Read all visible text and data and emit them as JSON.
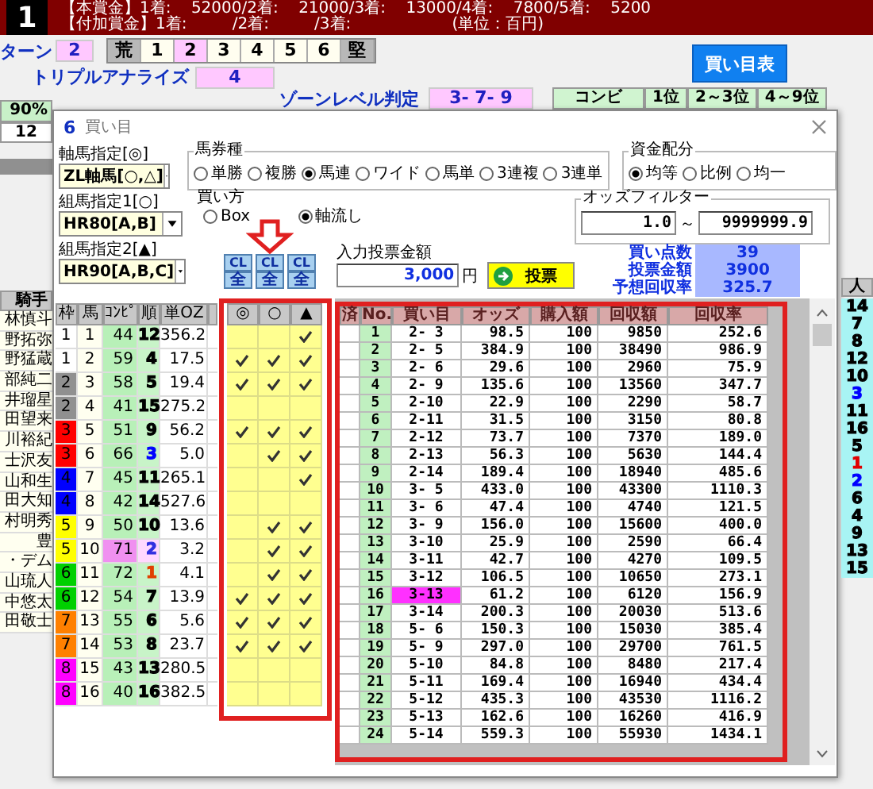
{
  "banner": {
    "race_number": "1",
    "lines": [
      "【本賞金】1着:    52000/2着:    21000/3着:    13000/4着:    7800/5着:    5200",
      "【付加賞金】1着:         /2着:         /3着:                    (単位：百円)"
    ]
  },
  "pattern": {
    "label": "ターン",
    "value": "2",
    "segments": [
      {
        "label": "荒",
        "kind": "cap",
        "selected": false
      },
      {
        "label": "1",
        "kind": "level",
        "selected": false
      },
      {
        "label": "2",
        "kind": "level",
        "selected": true
      },
      {
        "label": "3",
        "kind": "level",
        "selected": false
      },
      {
        "label": "4",
        "kind": "level",
        "selected": false
      },
      {
        "label": "5",
        "kind": "level",
        "selected": false
      },
      {
        "label": "6",
        "kind": "level",
        "selected": false
      },
      {
        "label": "堅",
        "kind": "cap",
        "selected": false
      }
    ]
  },
  "buy_table_button": "買い目表",
  "triple_analyze": {
    "label": "トリプルアナライズ",
    "value": "4"
  },
  "zone_level": {
    "label": "ゾーンレベル判定",
    "value": "3- 7- 9"
  },
  "combo_header": [
    "コンビ",
    "1位",
    "2～3位",
    "4～9位"
  ],
  "left_panel": {
    "percent": "90%",
    "count": "12"
  },
  "jockeys": {
    "header": "騎手",
    "names": [
      "林慎斗",
      "野拓弥",
      "野猛蔵",
      "部純二",
      "井瑠星",
      "田望来",
      "川裕紀",
      "士沢友",
      "山和生",
      "田大知",
      "村明秀",
      "豊",
      "・デム",
      "山琉人",
      "中悠太",
      "田敬士"
    ]
  },
  "popularity": {
    "header": "人",
    "items": [
      {
        "text": "14",
        "color": "#000000"
      },
      {
        "text": "7",
        "color": "#000000"
      },
      {
        "text": "8",
        "color": "#000000"
      },
      {
        "text": "12",
        "color": "#000000"
      },
      {
        "text": "10",
        "color": "#000000"
      },
      {
        "text": "3",
        "color": "#0000ff"
      },
      {
        "text": "11",
        "color": "#000000"
      },
      {
        "text": "16",
        "color": "#000000"
      },
      {
        "text": "5",
        "color": "#000000"
      },
      {
        "text": "1",
        "color": "#e00000"
      },
      {
        "text": "2",
        "color": "#0000ff"
      },
      {
        "text": "6",
        "color": "#000000"
      },
      {
        "text": "4",
        "color": "#000000"
      },
      {
        "text": "9",
        "color": "#000000"
      },
      {
        "text": "13",
        "color": "#000000"
      },
      {
        "text": "15",
        "color": "#000000"
      }
    ]
  },
  "dialog": {
    "number": "6",
    "title": "買い目",
    "axis": {
      "label": "軸馬指定[◎]",
      "value": "ZL軸馬[○,△]"
    },
    "partner1": {
      "label": "組馬指定1[○]",
      "value": "HR80[A,B]"
    },
    "partner2": {
      "label": "組馬指定2[▲]",
      "value": "HR90[A,B,C]"
    },
    "ticket_type": {
      "label": "馬券種",
      "options": [
        {
          "label": "単勝",
          "selected": false
        },
        {
          "label": "複勝",
          "selected": false
        },
        {
          "label": "馬連",
          "selected": true
        },
        {
          "label": "ワイド",
          "selected": false
        },
        {
          "label": "馬単",
          "selected": false
        },
        {
          "label": "3連複",
          "selected": false
        },
        {
          "label": "3連単",
          "selected": false
        }
      ]
    },
    "allocation": {
      "label": "資金配分",
      "options": [
        {
          "label": "均等",
          "selected": true
        },
        {
          "label": "比例",
          "selected": false
        },
        {
          "label": "均一",
          "selected": false
        }
      ]
    },
    "buy_method": {
      "label": "買い方",
      "options": [
        {
          "label": "Box",
          "selected": false
        },
        {
          "label": "軸流し",
          "selected": true
        }
      ]
    },
    "odds_filter": {
      "label": "オッズフィルター",
      "min": "1.0",
      "separator": "～",
      "max": "9999999.9"
    },
    "amount": {
      "label": "入力投票金額",
      "value": "3,000",
      "unit": "円"
    },
    "vote_button": "投票",
    "stats": [
      {
        "label": "買い点数",
        "value": "39"
      },
      {
        "label": "投票金額",
        "value": "3900"
      },
      {
        "label": "予想回収率",
        "value": "325.7"
      }
    ],
    "clear_buttons": [
      {
        "top": "CL",
        "bottom": "全"
      },
      {
        "top": "CL",
        "bottom": "全"
      },
      {
        "top": "CL",
        "bottom": "全"
      }
    ],
    "horse_columns": [
      "枠",
      "馬",
      "ｺﾝﾋﾟ",
      "順",
      "単OZ"
    ],
    "mark_columns": [
      "◎",
      "○",
      "▲"
    ],
    "horses": [
      {
        "frame": {
          "text": "1",
          "color": "#ffffff"
        },
        "number": "1",
        "compi": "44",
        "highlight": false,
        "rank": {
          "text": "12",
          "color": "#000000"
        },
        "odds": "356.2",
        "marks": [
          false,
          false,
          true
        ]
      },
      {
        "frame": {
          "text": "1",
          "color": "#ffffff"
        },
        "number": "2",
        "compi": "59",
        "highlight": false,
        "rank": {
          "text": "4",
          "color": "#000000"
        },
        "odds": "17.5",
        "marks": [
          true,
          true,
          true
        ]
      },
      {
        "frame": {
          "text": "2",
          "color": "#909090"
        },
        "number": "3",
        "compi": "58",
        "highlight": false,
        "rank": {
          "text": "5",
          "color": "#000000"
        },
        "odds": "19.4",
        "marks": [
          true,
          true,
          true
        ]
      },
      {
        "frame": {
          "text": "2",
          "color": "#909090"
        },
        "number": "4",
        "compi": "41",
        "highlight": false,
        "rank": {
          "text": "15",
          "color": "#000000"
        },
        "odds": "275.2",
        "marks": [
          false,
          false,
          false
        ]
      },
      {
        "frame": {
          "text": "3",
          "color": "#ff0000"
        },
        "number": "5",
        "compi": "51",
        "highlight": false,
        "rank": {
          "text": "9",
          "color": "#000000"
        },
        "odds": "56.2",
        "marks": [
          true,
          true,
          true
        ]
      },
      {
        "frame": {
          "text": "3",
          "color": "#ff0000"
        },
        "number": "6",
        "compi": "66",
        "highlight": false,
        "rank": {
          "text": "3",
          "color": "#0000ff"
        },
        "odds": "5.0",
        "marks": [
          false,
          true,
          true
        ]
      },
      {
        "frame": {
          "text": "4",
          "color": "#0000ff"
        },
        "number": "7",
        "compi": "45",
        "highlight": false,
        "rank": {
          "text": "11",
          "color": "#000000"
        },
        "odds": "265.1",
        "marks": [
          false,
          false,
          true
        ]
      },
      {
        "frame": {
          "text": "4",
          "color": "#0000ff"
        },
        "number": "8",
        "compi": "42",
        "highlight": false,
        "rank": {
          "text": "14",
          "color": "#000000"
        },
        "odds": "527.6",
        "marks": [
          false,
          false,
          false
        ]
      },
      {
        "frame": {
          "text": "5",
          "color": "#ffff00"
        },
        "number": "9",
        "compi": "50",
        "highlight": false,
        "rank": {
          "text": "10",
          "color": "#000000"
        },
        "odds": "13.6",
        "marks": [
          false,
          true,
          true
        ]
      },
      {
        "frame": {
          "text": "5",
          "color": "#ffff00"
        },
        "number": "10",
        "compi": "71",
        "highlight": true,
        "rank": {
          "text": "2",
          "color": "#3030e0"
        },
        "odds": "3.2",
        "marks": [
          false,
          true,
          true
        ]
      },
      {
        "frame": {
          "text": "6",
          "color": "#00d000"
        },
        "number": "11",
        "compi": "72",
        "highlight": false,
        "rank": {
          "text": "1",
          "color": "#e04000"
        },
        "odds": "4.1",
        "marks": [
          false,
          true,
          true
        ]
      },
      {
        "frame": {
          "text": "6",
          "color": "#00d000"
        },
        "number": "12",
        "compi": "54",
        "highlight": false,
        "rank": {
          "text": "7",
          "color": "#000000"
        },
        "odds": "13.9",
        "marks": [
          true,
          true,
          true
        ]
      },
      {
        "frame": {
          "text": "7",
          "color": "#ff8000"
        },
        "number": "13",
        "compi": "55",
        "highlight": false,
        "rank": {
          "text": "6",
          "color": "#000000"
        },
        "odds": "5.6",
        "marks": [
          true,
          true,
          true
        ]
      },
      {
        "frame": {
          "text": "7",
          "color": "#ff8000"
        },
        "number": "14",
        "compi": "53",
        "highlight": false,
        "rank": {
          "text": "8",
          "color": "#000000"
        },
        "odds": "23.7",
        "marks": [
          true,
          true,
          true
        ]
      },
      {
        "frame": {
          "text": "8",
          "color": "#ff00ff"
        },
        "number": "15",
        "compi": "43",
        "highlight": false,
        "rank": {
          "text": "13",
          "color": "#000000"
        },
        "odds": "280.5",
        "marks": [
          false,
          false,
          false
        ]
      },
      {
        "frame": {
          "text": "8",
          "color": "#ff00ff"
        },
        "number": "16",
        "compi": "40",
        "highlight": false,
        "rank": {
          "text": "16",
          "color": "#000000"
        },
        "odds": "382.5",
        "marks": [
          false,
          false,
          false
        ]
      }
    ],
    "bet_columns": [
      "済",
      "No.",
      "買い目",
      "オッズ",
      "購入額",
      "回収額",
      "回収率"
    ],
    "bets": [
      {
        "no": "1",
        "combo": "2- 3",
        "odds": "98.5",
        "stake": "100",
        "payout": "9850",
        "rate": "252.6",
        "highlighted": false
      },
      {
        "no": "2",
        "combo": "2- 5",
        "odds": "384.9",
        "stake": "100",
        "payout": "38490",
        "rate": "986.9",
        "highlighted": false
      },
      {
        "no": "3",
        "combo": "2- 6",
        "odds": "29.6",
        "stake": "100",
        "payout": "2960",
        "rate": "75.9",
        "highlighted": false
      },
      {
        "no": "4",
        "combo": "2- 9",
        "odds": "135.6",
        "stake": "100",
        "payout": "13560",
        "rate": "347.7",
        "highlighted": false
      },
      {
        "no": "5",
        "combo": "2-10",
        "odds": "22.9",
        "stake": "100",
        "payout": "2290",
        "rate": "58.7",
        "highlighted": false
      },
      {
        "no": "6",
        "combo": "2-11",
        "odds": "31.5",
        "stake": "100",
        "payout": "3150",
        "rate": "80.8",
        "highlighted": false
      },
      {
        "no": "7",
        "combo": "2-12",
        "odds": "73.7",
        "stake": "100",
        "payout": "7370",
        "rate": "189.0",
        "highlighted": false
      },
      {
        "no": "8",
        "combo": "2-13",
        "odds": "56.3",
        "stake": "100",
        "payout": "5630",
        "rate": "144.4",
        "highlighted": false
      },
      {
        "no": "9",
        "combo": "2-14",
        "odds": "189.4",
        "stake": "100",
        "payout": "18940",
        "rate": "485.6",
        "highlighted": false
      },
      {
        "no": "10",
        "combo": "3- 5",
        "odds": "433.0",
        "stake": "100",
        "payout": "43300",
        "rate": "1110.3",
        "highlighted": false
      },
      {
        "no": "11",
        "combo": "3- 6",
        "odds": "47.4",
        "stake": "100",
        "payout": "4740",
        "rate": "121.5",
        "highlighted": false
      },
      {
        "no": "12",
        "combo": "3- 9",
        "odds": "156.0",
        "stake": "100",
        "payout": "15600",
        "rate": "400.0",
        "highlighted": false
      },
      {
        "no": "13",
        "combo": "3-10",
        "odds": "25.9",
        "stake": "100",
        "payout": "2590",
        "rate": "66.4",
        "highlighted": false
      },
      {
        "no": "14",
        "combo": "3-11",
        "odds": "42.7",
        "stake": "100",
        "payout": "4270",
        "rate": "109.5",
        "highlighted": false
      },
      {
        "no": "15",
        "combo": "3-12",
        "odds": "106.5",
        "stake": "100",
        "payout": "10650",
        "rate": "273.1",
        "highlighted": false
      },
      {
        "no": "16",
        "combo": "3-13",
        "odds": "61.2",
        "stake": "100",
        "payout": "6120",
        "rate": "156.9",
        "highlighted": true
      },
      {
        "no": "17",
        "combo": "3-14",
        "odds": "200.3",
        "stake": "100",
        "payout": "20030",
        "rate": "513.6",
        "highlighted": false
      },
      {
        "no": "18",
        "combo": "5- 6",
        "odds": "150.3",
        "stake": "100",
        "payout": "15030",
        "rate": "385.4",
        "highlighted": false
      },
      {
        "no": "19",
        "combo": "5- 9",
        "odds": "297.0",
        "stake": "100",
        "payout": "29700",
        "rate": "761.5",
        "highlighted": false
      },
      {
        "no": "20",
        "combo": "5-10",
        "odds": "84.8",
        "stake": "100",
        "payout": "8480",
        "rate": "217.4",
        "highlighted": false
      },
      {
        "no": "21",
        "combo": "5-11",
        "odds": "169.4",
        "stake": "100",
        "payout": "16940",
        "rate": "434.4",
        "highlighted": false
      },
      {
        "no": "22",
        "combo": "5-12",
        "odds": "435.3",
        "stake": "100",
        "payout": "43530",
        "rate": "1116.2",
        "highlighted": false
      },
      {
        "no": "23",
        "combo": "5-13",
        "odds": "162.6",
        "stake": "100",
        "payout": "16260",
        "rate": "416.9",
        "highlighted": false
      },
      {
        "no": "24",
        "combo": "5-14",
        "odds": "559.3",
        "stake": "100",
        "payout": "55930",
        "rate": "1434.1",
        "highlighted": false
      }
    ]
  }
}
